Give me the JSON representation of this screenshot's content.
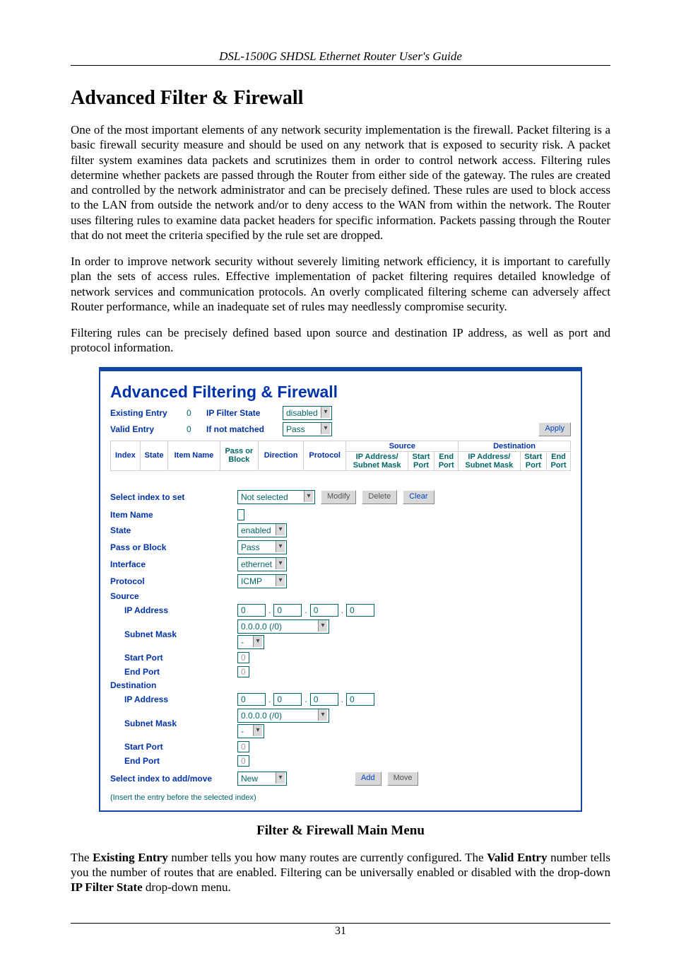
{
  "running_head": "DSL-1500G SHDSL Ethernet Router User's Guide",
  "section_title": "Advanced Filter & Firewall",
  "paragraphs": [
    "One of the most important elements of any network security implementation is the firewall. Packet filtering is a basic firewall security measure and should be used on any network that is exposed to security risk. A packet filter system examines data packets and scrutinizes them in order to control network access. Filtering rules determine whether packets are passed through the Router from either side of the gateway. The rules are created and controlled by the network administrator and can be precisely defined. These rules are used to block access to the LAN from outside the network and/or to deny access to the WAN from within the network. The Router uses filtering rules to examine data packet headers for specific information. Packets passing through the Router that do not meet the criteria specified by the rule set are dropped.",
    "In order to improve network security without severely limiting network efficiency, it is important to carefully plan the sets of access rules. Effective implementation of packet filtering requires detailed knowledge of network services and communication protocols. An overly complicated filtering scheme can adversely affect Router performance, while an inadequate set of rules may needlessly compromise security.",
    "Filtering rules can be precisely defined based upon source and destination IP address, as well as port and protocol information."
  ],
  "panel": {
    "title": "Advanced Filtering & Firewall",
    "existing_entry_label": "Existing Entry",
    "existing_entry_value": "0",
    "ip_filter_state_label": "IP Filter State",
    "ip_filter_state_value": "disabled",
    "valid_entry_label": "Valid Entry",
    "valid_entry_value": "0",
    "if_not_matched_label": "If not matched",
    "if_not_matched_value": "Pass",
    "apply_label": "Apply",
    "cols": {
      "index": "Index",
      "state": "State",
      "item_name": "Item Name",
      "pass_or_block": "Pass or\nBlock",
      "direction": "Direction",
      "protocol": "Protocol",
      "source": "Source",
      "destination": "Destination",
      "ip_addr_mask": "IP Address/\nSubnet Mask",
      "start_port": "Start\nPort",
      "end_port": "End\nPort"
    },
    "form": {
      "select_index_to_set": "Select index to set",
      "select_index_value": "Not selected",
      "modify": "Modify",
      "delete": "Delete",
      "clear": "Clear",
      "item_name": "Item Name",
      "item_name_value": "",
      "state": "State",
      "state_value": "enabled",
      "pass_or_block": "Pass or Block",
      "pass_or_block_value": "Pass",
      "interface": "Interface",
      "interface_value": "ethernet",
      "protocol": "Protocol",
      "protocol_value": "ICMP",
      "source": "Source",
      "destination": "Destination",
      "ip_address": "IP Address",
      "ip": [
        "0",
        "0",
        "0",
        "0"
      ],
      "subnet_mask": "Subnet Mask",
      "subnet_mask_value": "0.0.0.0 (/0)",
      "subnet_mask_extra": "-",
      "start_port": "Start Port",
      "start_port_value": "0",
      "end_port": "End Port",
      "end_port_value": "0",
      "select_index_add": "Select index to add/move",
      "select_index_add_value": "New",
      "add": "Add",
      "move": "Move",
      "insert_note": "(Insert the entry before the selected index)"
    }
  },
  "caption": "Filter & Firewall Main Menu",
  "tail_paragraph_parts": {
    "p1": "The ",
    "b1": "Existing Entry",
    "p2": " number tells you how many routes are currently configured. The ",
    "b2": "Valid Entry",
    "p3": " number tells you the number of routes that are enabled. Filtering can be universally enabled or disabled with the drop-down ",
    "b3": "IP Filter State",
    "p4": " drop-down menu."
  },
  "page_number": "31"
}
